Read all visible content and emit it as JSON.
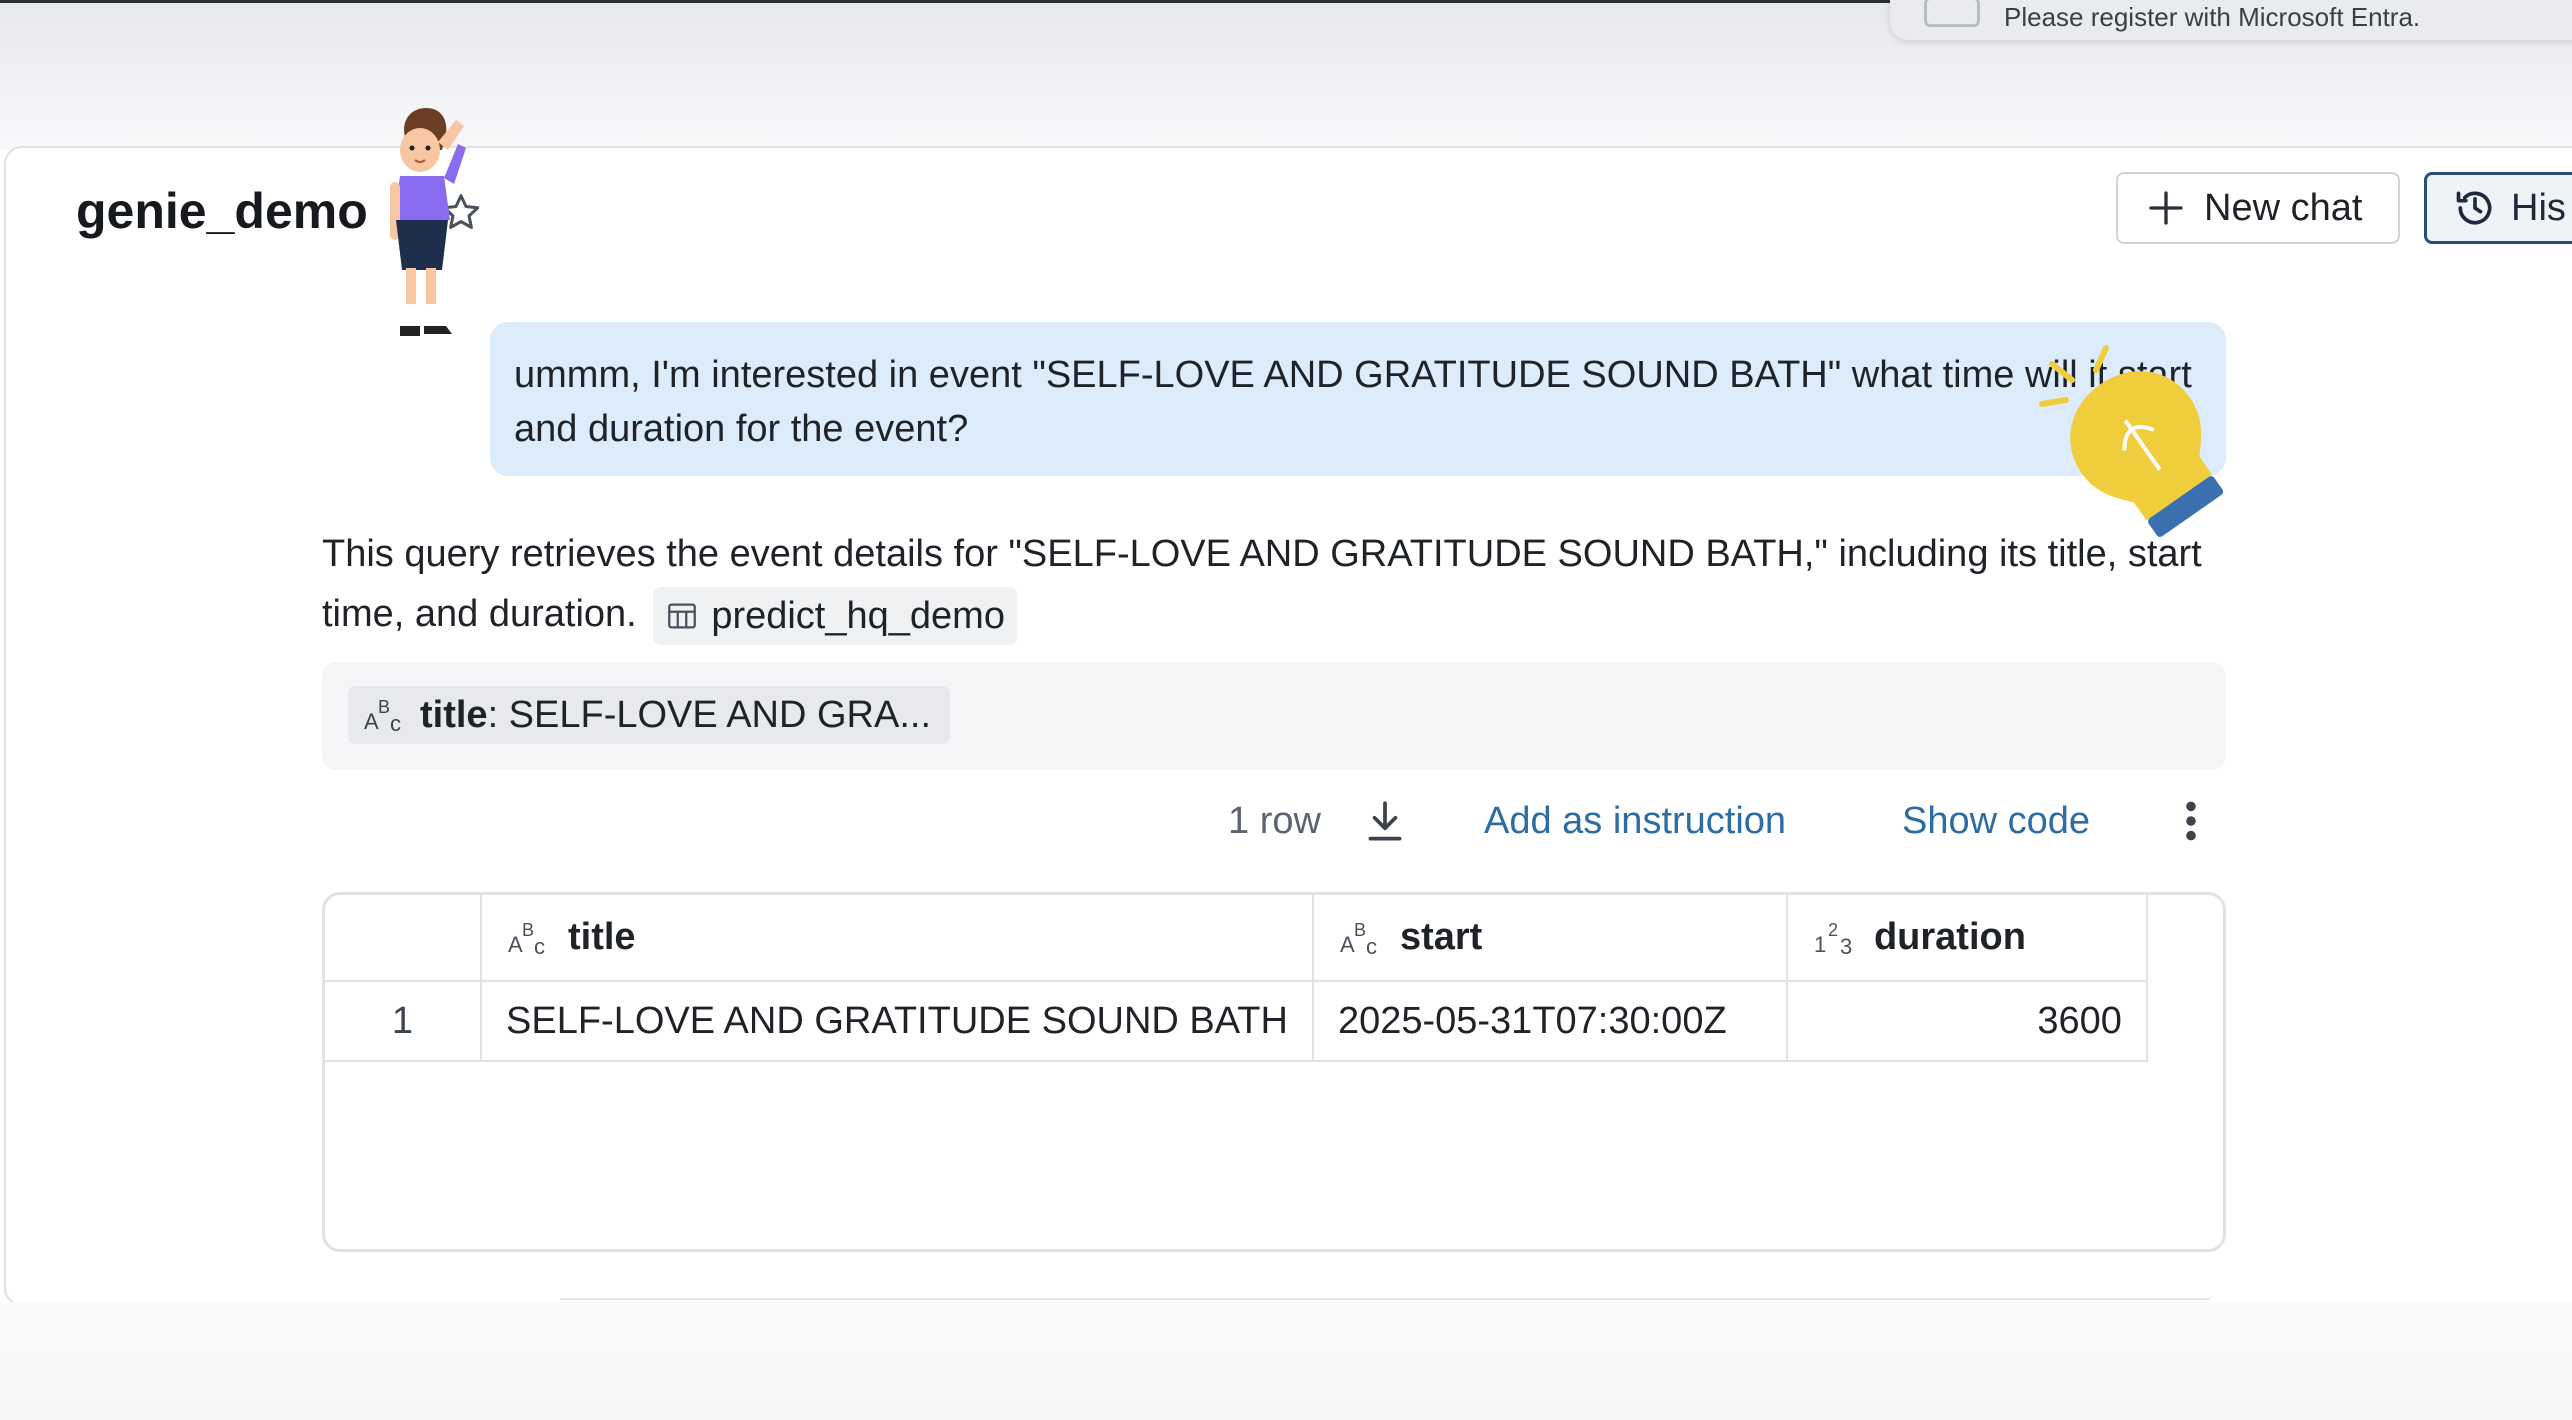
{
  "toast": {
    "text": "Please register with Microsoft Entra."
  },
  "header": {
    "title": "genie_demo",
    "new_chat_label": "New chat",
    "history_label": "His"
  },
  "conversation": {
    "user_message": "ummm, I'm interested in event \"SELF-LOVE AND GRATITUDE SOUND BATH\" what time will it start and duration for the event?",
    "answer_text": "This query retrieves the event details for \"SELF-LOVE AND GRATITUDE SOUND BATH,\" including its title, start time, and duration.",
    "table_ref": "predict_hq_demo"
  },
  "filter": {
    "field": "title",
    "value": ": SELF-LOVE AND GRA..."
  },
  "result_toolbar": {
    "row_count": "1 row",
    "add_instruction": "Add as instruction",
    "show_code": "Show code"
  },
  "result_table": {
    "columns": [
      {
        "name": "title",
        "type_icon": "string-type-icon"
      },
      {
        "name": "start",
        "type_icon": "string-type-icon"
      },
      {
        "name": "duration",
        "type_icon": "number-type-icon"
      }
    ],
    "rows": [
      {
        "index": "1",
        "title": "SELF-LOVE AND GRATITUDE SOUND BATH",
        "start": "2025-05-31T07:30:00Z",
        "duration": "3600"
      }
    ]
  },
  "colors": {
    "user_bubble": "#dcecfa",
    "link": "#2e6da4",
    "history_border": "#2b4e74"
  }
}
